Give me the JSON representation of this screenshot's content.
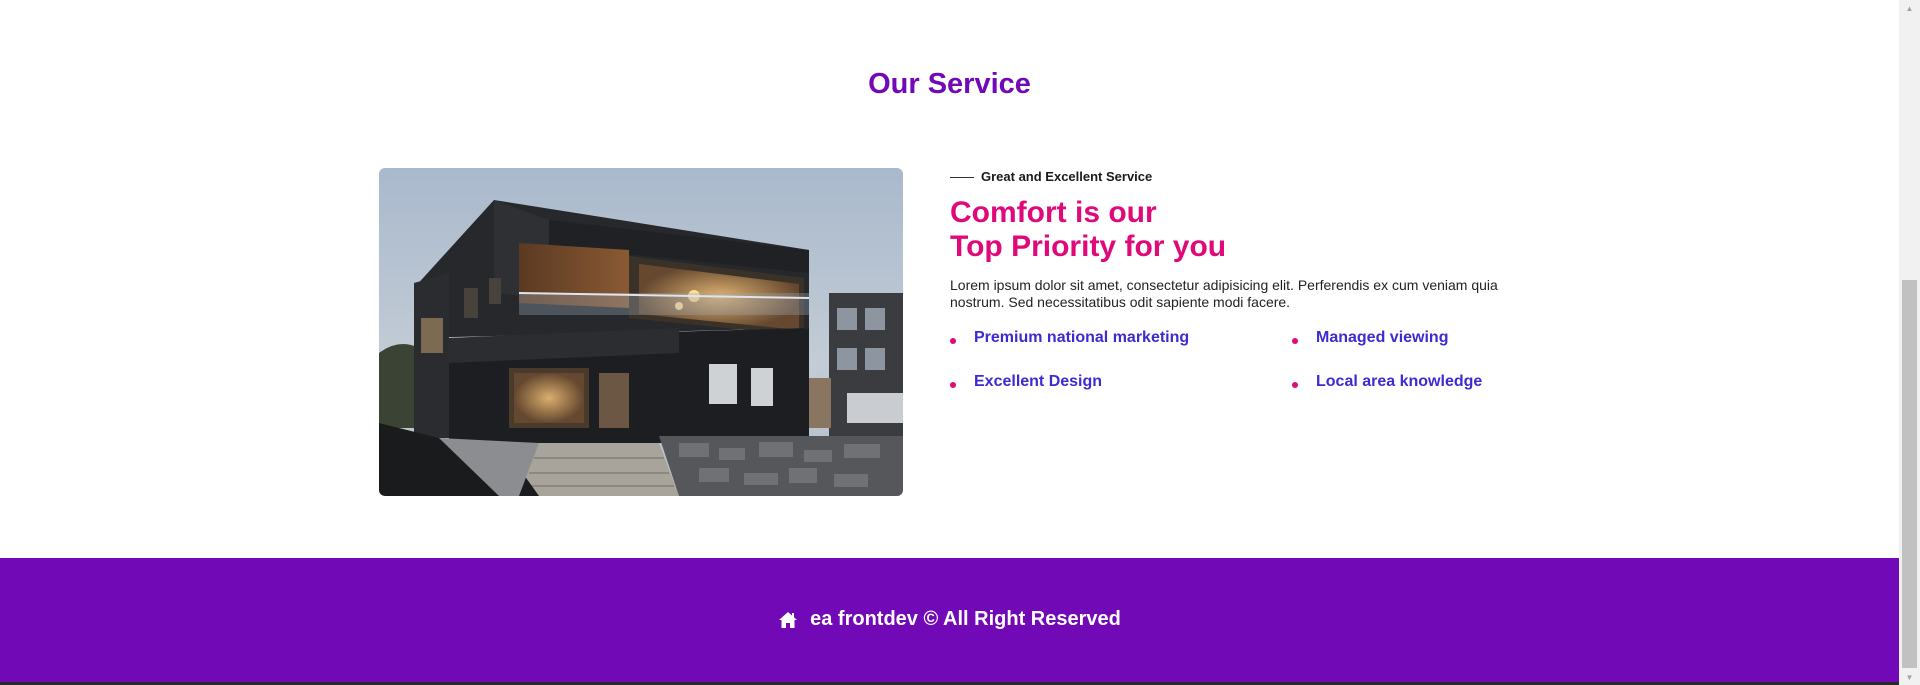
{
  "service": {
    "title": "Our Service",
    "eyebrow": "Great and Excellent Service",
    "headline_line1": "Comfort is our",
    "headline_line2": "Top Priority for you",
    "description": "Lorem ipsum dolor sit amet, consectetur adipisicing elit. Perferendis ex cum veniam quia nostrum. Sed necessitatibus odit sapiente modi facere.",
    "features": [
      "Premium national marketing",
      "Managed viewing",
      "Excellent Design",
      "Local area knowledge"
    ],
    "image_subject": "modern-house-photo"
  },
  "footer": {
    "icon": "home-icon",
    "text": "ea frontdev © All Right Reserved"
  },
  "colors": {
    "accent_purple": "#7209b7",
    "headline_pink": "#e0097a",
    "feature_blue": "#3d2bd1"
  }
}
